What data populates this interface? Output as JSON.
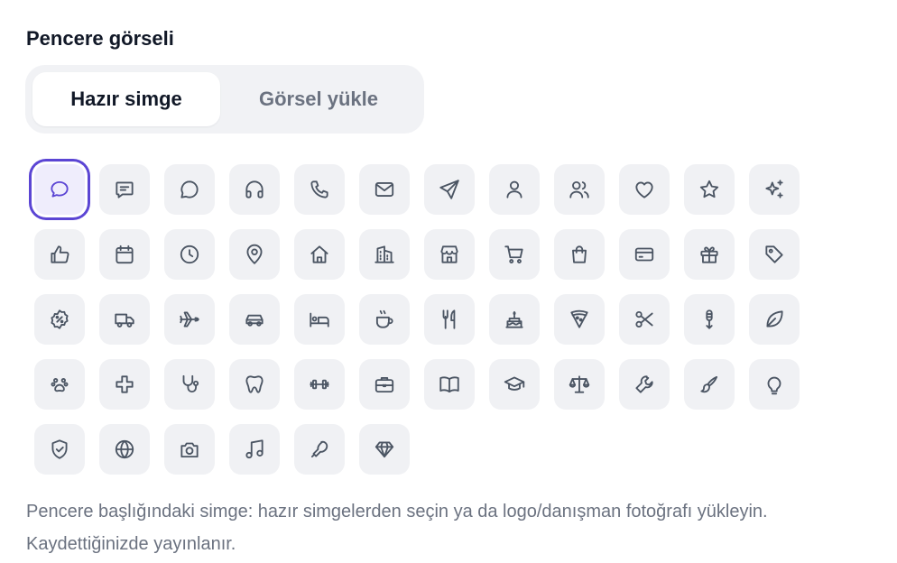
{
  "section_title": "Pencere görseli",
  "tabs": {
    "preset_label": "Hazır simge",
    "upload_label": "Görsel yükle",
    "active": "preset"
  },
  "icons": [
    "chat-bubble",
    "message-square",
    "chat-round",
    "headphones",
    "phone",
    "mail",
    "send",
    "user",
    "users",
    "heart",
    "star",
    "sparkles",
    "thumbs-up",
    "calendar",
    "clock",
    "map-pin",
    "home",
    "building",
    "store",
    "cart",
    "shopping-bag",
    "credit-card",
    "gift",
    "tag",
    "discount-badge",
    "truck",
    "plane",
    "car",
    "bed",
    "coffee",
    "utensils",
    "cake",
    "pizza",
    "scissors",
    "microphone",
    "leaf",
    "paw",
    "medical-cross",
    "stethoscope",
    "tooth",
    "dumbbell",
    "briefcase",
    "book-open",
    "graduation-cap",
    "scale",
    "wrench",
    "paintbrush",
    "lightbulb",
    "shield-check",
    "globe",
    "camera",
    "music",
    "tennis-racket",
    "diamond"
  ],
  "selected_icon": "chat-bubble",
  "help_text": "Pencere başlığındaki simge: hazır simgelerden seçin ya da logo/danışman fotoğrafı yükleyin. Kaydettiğinizde yayınlanır.",
  "colors": {
    "accent": "#5b45d4",
    "tile_bg": "#f0f1f4",
    "icon_stroke": "#4b5563",
    "muted_text": "#6b7280"
  }
}
